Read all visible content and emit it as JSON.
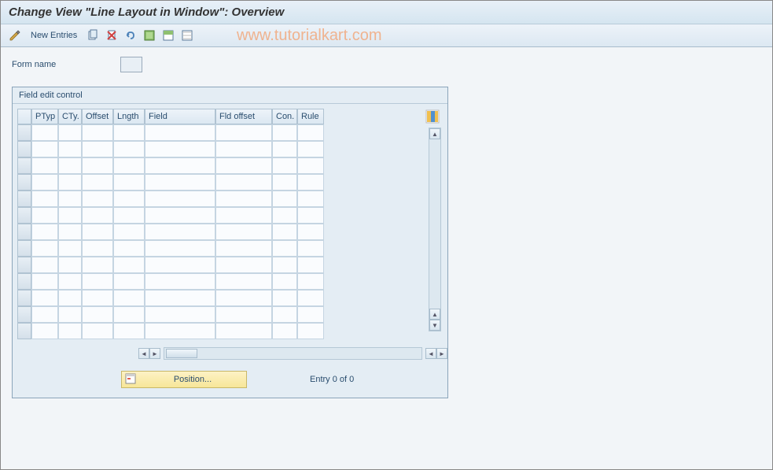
{
  "title": "Change View \"Line Layout in Window\": Overview",
  "toolbar": {
    "new_entries_label": "New Entries"
  },
  "watermark": "www.tutorialkart.com",
  "form": {
    "name_label": "Form name",
    "name_value": ""
  },
  "grid": {
    "title": "Field edit control",
    "columns": {
      "ptyp": "PTyp",
      "cty": "CTy.",
      "offset": "Offset",
      "lngth": "Lngth",
      "field": "Field",
      "fld_offset": "Fld offset",
      "con": "Con.",
      "rule": "Rule"
    },
    "num_visible_rows": 13
  },
  "footer": {
    "position_label": "Position...",
    "entry_text": "Entry 0 of 0"
  }
}
